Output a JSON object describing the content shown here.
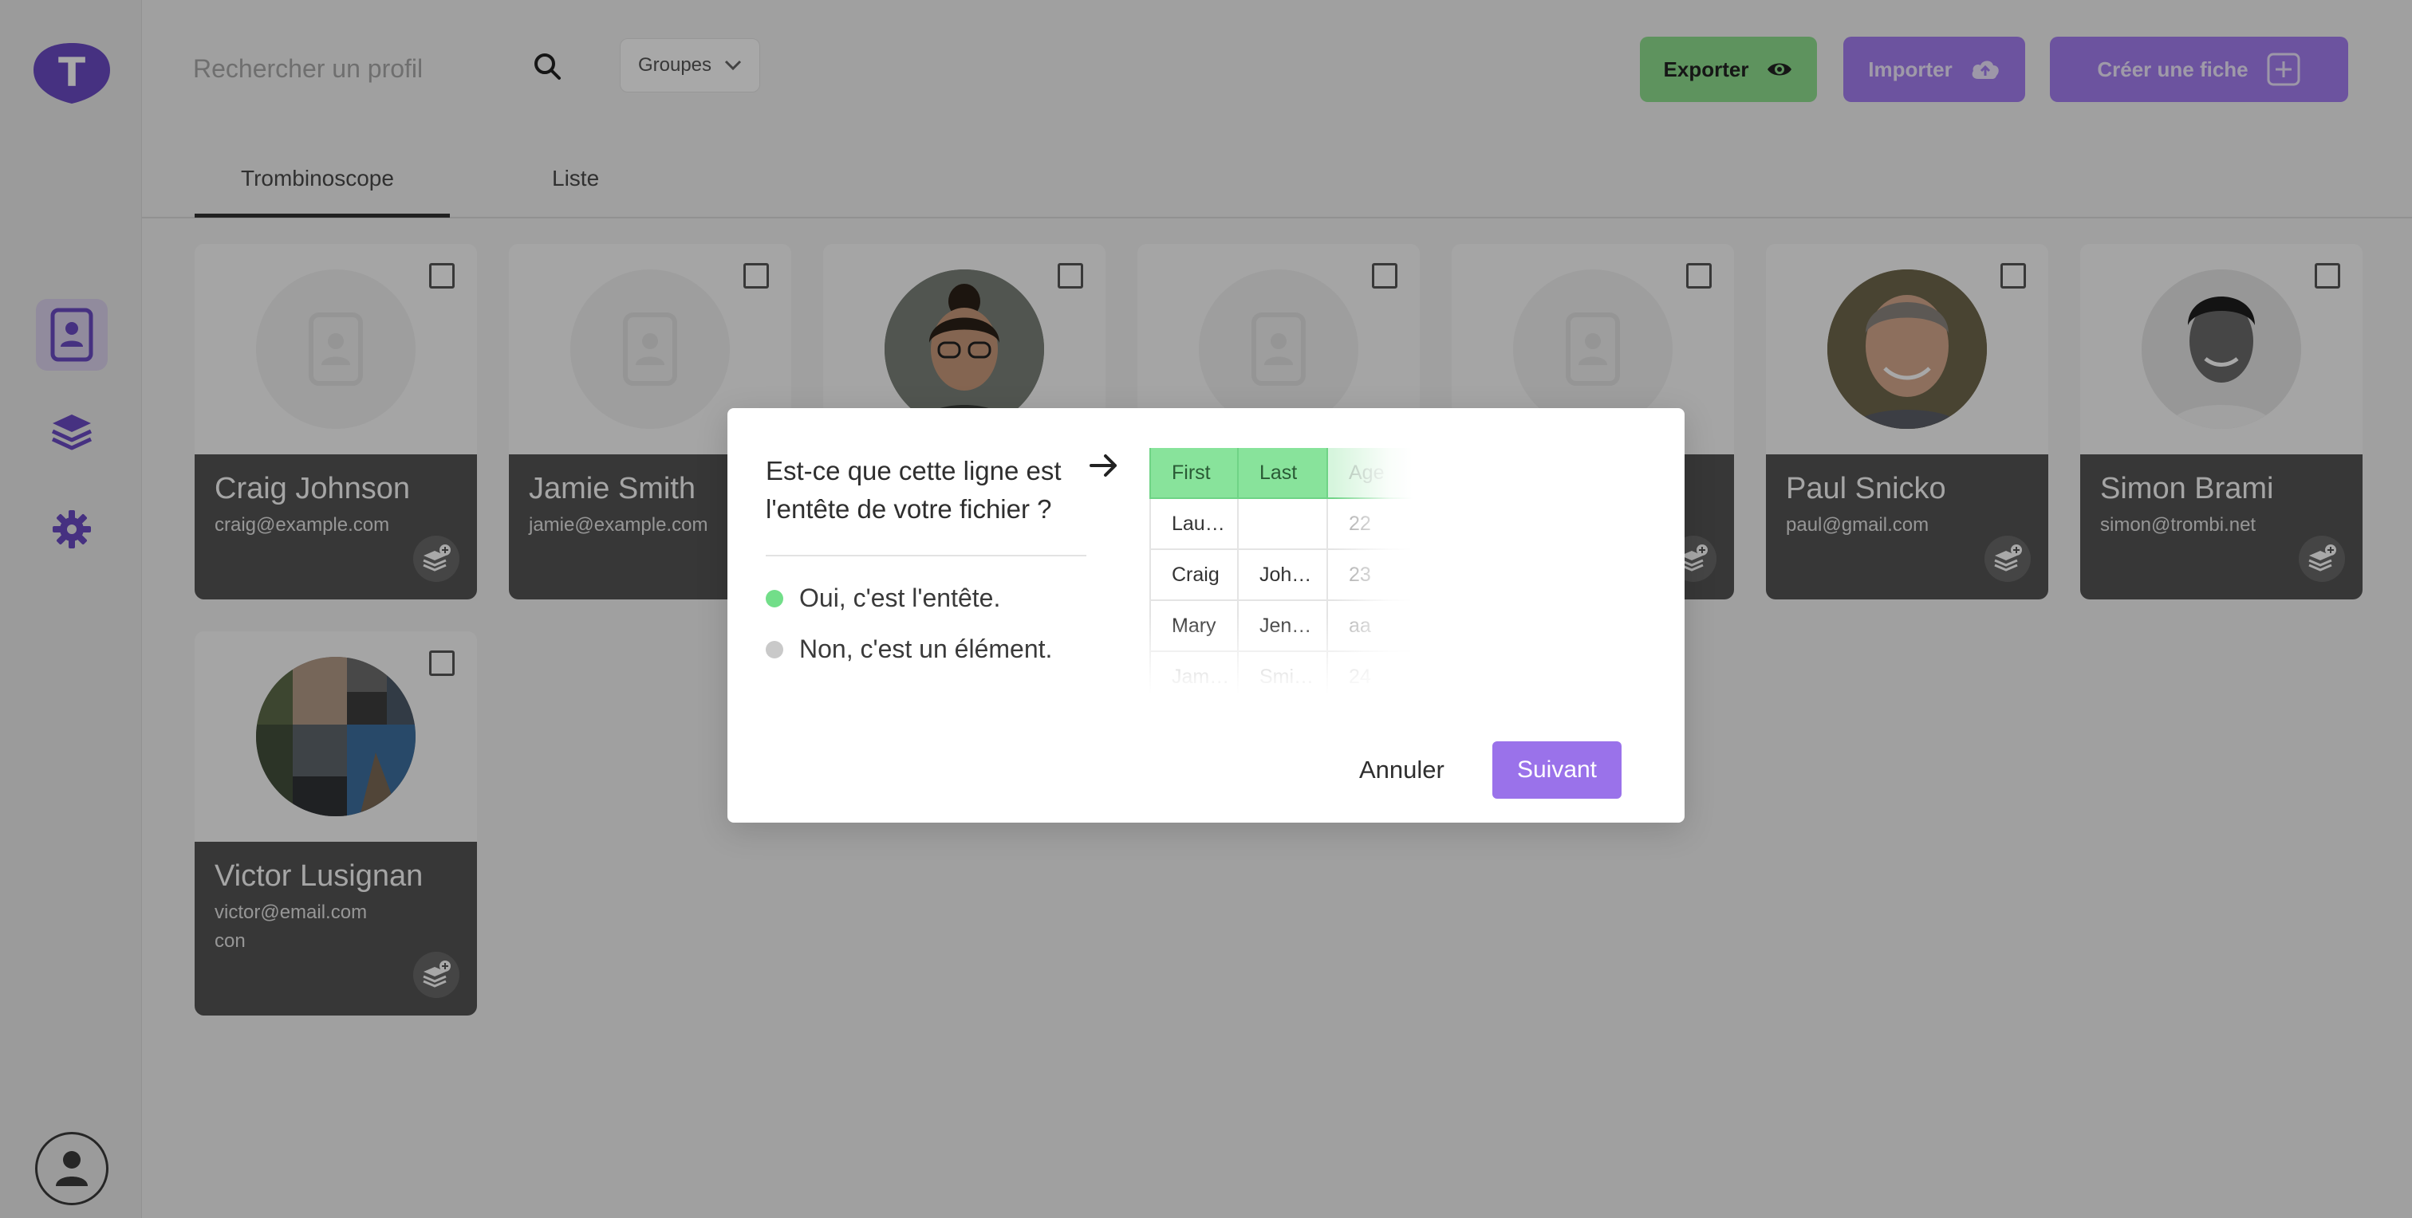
{
  "app": {
    "logo_letter": "T",
    "colors": {
      "accent": "#a57ff2",
      "export_green": "#8fe08f",
      "header_green": "#88e39b"
    }
  },
  "sidebar": {
    "items": [
      {
        "icon": "contact-card-icon",
        "active": true
      },
      {
        "icon": "layers-icon",
        "active": false
      },
      {
        "icon": "gear-icon",
        "active": false
      }
    ],
    "profile_icon": "user-avatar-icon"
  },
  "header": {
    "search_placeholder": "Rechercher un profil",
    "groups_label": "Groupes",
    "export_label": "Exporter",
    "import_label": "Importer",
    "create_label": "Créer une fiche"
  },
  "tabs": [
    {
      "label": "Trombinoscope",
      "active": true
    },
    {
      "label": "Liste",
      "active": false
    }
  ],
  "cards": [
    {
      "name": "Craig Johnson",
      "email": "craig@example.com",
      "extra": ""
    },
    {
      "name": "Jamie Smith",
      "email": "jamie@example.com",
      "extra": ""
    },
    {
      "name": "",
      "email": "",
      "extra": ""
    },
    {
      "name": "",
      "email": "",
      "extra": ""
    },
    {
      "name": "",
      "email": "",
      "extra": ""
    },
    {
      "name": "Paul Snicko",
      "email": "paul@gmail.com",
      "extra": ""
    },
    {
      "name": "Simon Brami",
      "email": "simon@trombi.net",
      "extra": ""
    },
    {
      "name": "Victor Lusignan",
      "email": "victor@email.com",
      "extra": "con"
    }
  ],
  "modal": {
    "question": "Est-ce que cette ligne est l'entête de votre fichier ?",
    "option_yes": "Oui, c'est l'entête.",
    "option_no": "Non, c'est un élément.",
    "preview": {
      "header": [
        "First",
        "Last",
        "Age"
      ],
      "rows": [
        [
          "Lau…",
          "",
          "22"
        ],
        [
          "Craig",
          "Joh…",
          "23"
        ],
        [
          "Mary",
          "Jen…",
          "aa"
        ],
        [
          "Jam…",
          "Smi…",
          "24"
        ]
      ]
    },
    "cancel_label": "Annuler",
    "next_label": "Suivant"
  }
}
